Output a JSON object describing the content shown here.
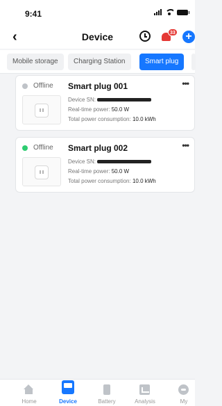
{
  "status_bar": {
    "time": "9:41"
  },
  "header": {
    "back_icon": "chevron-left-icon",
    "title": "Device",
    "history_icon": "history-icon",
    "alarm_icon": "alarm-icon",
    "alarm_badge": "33",
    "add_icon": "plus-circle-icon",
    "accent_color": "#1677ff",
    "alarm_color": "#e53935"
  },
  "tabs": [
    {
      "label": "Mobile storage",
      "selected": false
    },
    {
      "label": "Charging Station",
      "selected": false
    },
    {
      "label": "Smart plug",
      "selected": true
    }
  ],
  "devices": [
    {
      "status": "Offline",
      "status_color": "#bfc3c8",
      "name": "Smart plug 001",
      "sn_label": "Device SN:",
      "power_label": "Real-time power:",
      "power_value": "50.0 W",
      "consumption_label": "Total power consumption:",
      "consumption_value": "10.0 kWh",
      "more": "•••"
    },
    {
      "status": "Offline",
      "status_color": "#2ecc71",
      "name": "Smart plug 002",
      "sn_label": "Device SN:",
      "power_label": "Real-time power:",
      "power_value": "50.0 W",
      "consumption_label": "Total power consumption:",
      "consumption_value": "10.0 kWh",
      "more": "•••"
    }
  ],
  "bottom_nav": [
    {
      "label": "Home",
      "icon": "home-icon",
      "active": false
    },
    {
      "label": "Device",
      "icon": "device-icon",
      "active": true
    },
    {
      "label": "Battery",
      "icon": "battery-icon",
      "active": false
    },
    {
      "label": "Analysis",
      "icon": "analysis-icon",
      "active": false
    },
    {
      "label": "My",
      "icon": "user-icon",
      "active": false
    }
  ]
}
